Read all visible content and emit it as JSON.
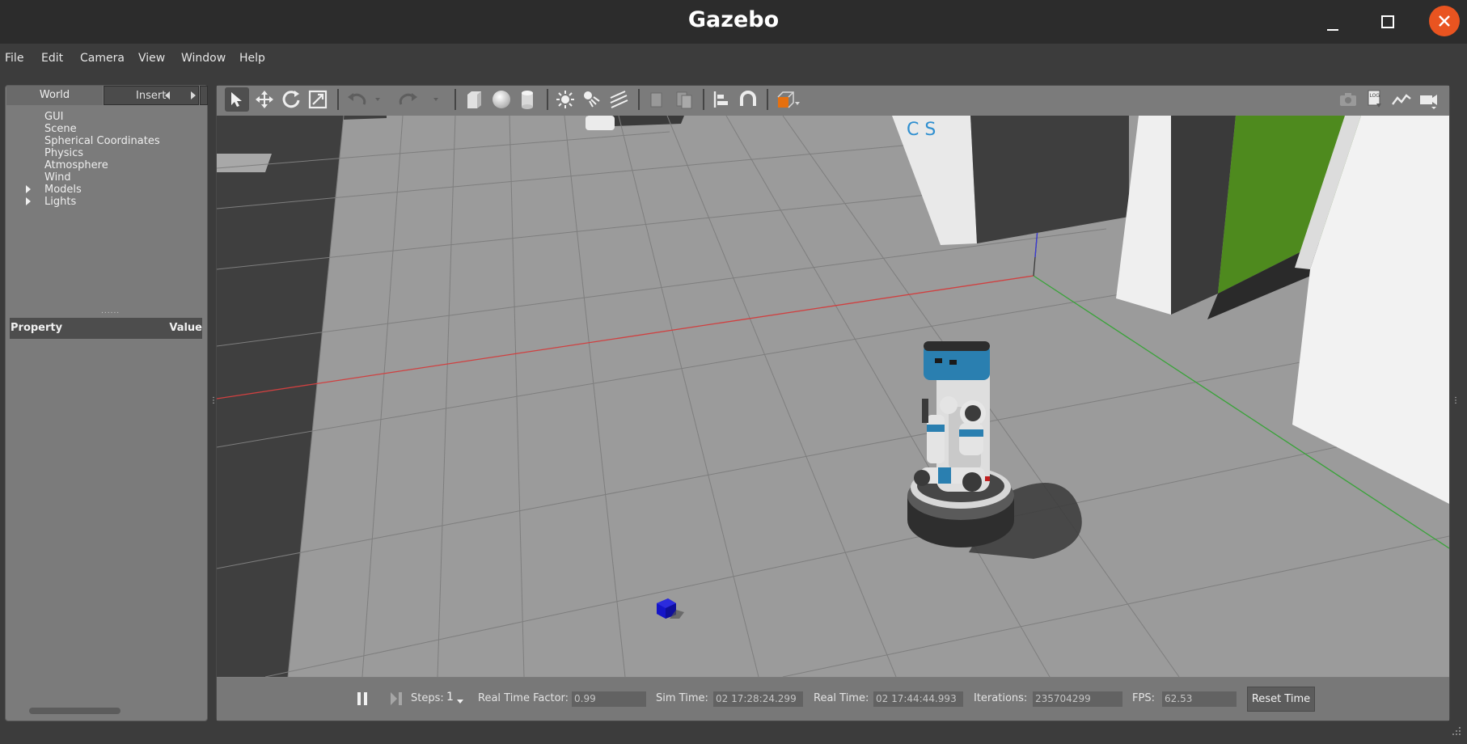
{
  "window": {
    "title": "Gazebo",
    "controls": [
      "minimize-icon",
      "maximize-icon",
      "close-icon"
    ],
    "close_color": "#e95420"
  },
  "menu": {
    "items": [
      {
        "label": "File"
      },
      {
        "label": "Edit"
      },
      {
        "label": "Camera"
      },
      {
        "label": "View"
      },
      {
        "label": "Window"
      },
      {
        "label": "Help"
      }
    ]
  },
  "left_panel": {
    "tabs": [
      {
        "label": "World",
        "active": true
      },
      {
        "label": "Insert",
        "active": false
      }
    ],
    "tree": [
      {
        "label": "GUI",
        "expandable": false
      },
      {
        "label": "Scene",
        "expandable": false
      },
      {
        "label": "Spherical Coordinates",
        "expandable": false
      },
      {
        "label": "Physics",
        "expandable": false
      },
      {
        "label": "Atmosphere",
        "expandable": false
      },
      {
        "label": "Wind",
        "expandable": false
      },
      {
        "label": "Models",
        "expandable": true
      },
      {
        "label": "Lights",
        "expandable": true
      }
    ],
    "splitter": "......",
    "property_table": {
      "property_header": "Property",
      "value_header": "Value"
    }
  },
  "toolbar": {
    "icons": [
      "select-arrow-icon",
      "translate-icon",
      "rotate-icon",
      "scale-icon",
      "undo-icon",
      "undo-dropdown-icon",
      "redo-icon",
      "redo-dropdown-icon",
      "box-shape-icon",
      "sphere-shape-icon",
      "cylinder-shape-icon",
      "point-light-icon",
      "spot-light-icon",
      "directional-light-icon",
      "copy-icon",
      "paste-icon",
      "align-icon",
      "snap-magnet-icon",
      "view-angle-icon"
    ],
    "right_icons": [
      "screenshot-camera-icon",
      "log-icon",
      "plot-icon",
      "video-record-icon"
    ]
  },
  "sim_controls": {
    "steps_label": "Steps:",
    "steps_value": "1",
    "rtf_label": "Real Time Factor:",
    "rtf_value": "0.99",
    "sim_time_label": "Sim Time:",
    "sim_time_value": "02 17:28:24.299",
    "real_time_label": "Real Time:",
    "real_time_value": "02 17:44:44.993",
    "iterations_label": "Iterations:",
    "iterations_value": "235704299",
    "fps_label": "FPS:",
    "fps_value": "62.53",
    "reset_label": "Reset Time"
  },
  "scene": {
    "wall_lettering": "C S",
    "colors": {
      "ground": "#9b9b9b",
      "green_wall": "#4e8a1e",
      "robot_accent": "#2a7fb0",
      "cube": "#1515c8",
      "x_axis": "#d04040",
      "y_axis": "#39a339",
      "z_axis": "#3a3ad8"
    }
  }
}
